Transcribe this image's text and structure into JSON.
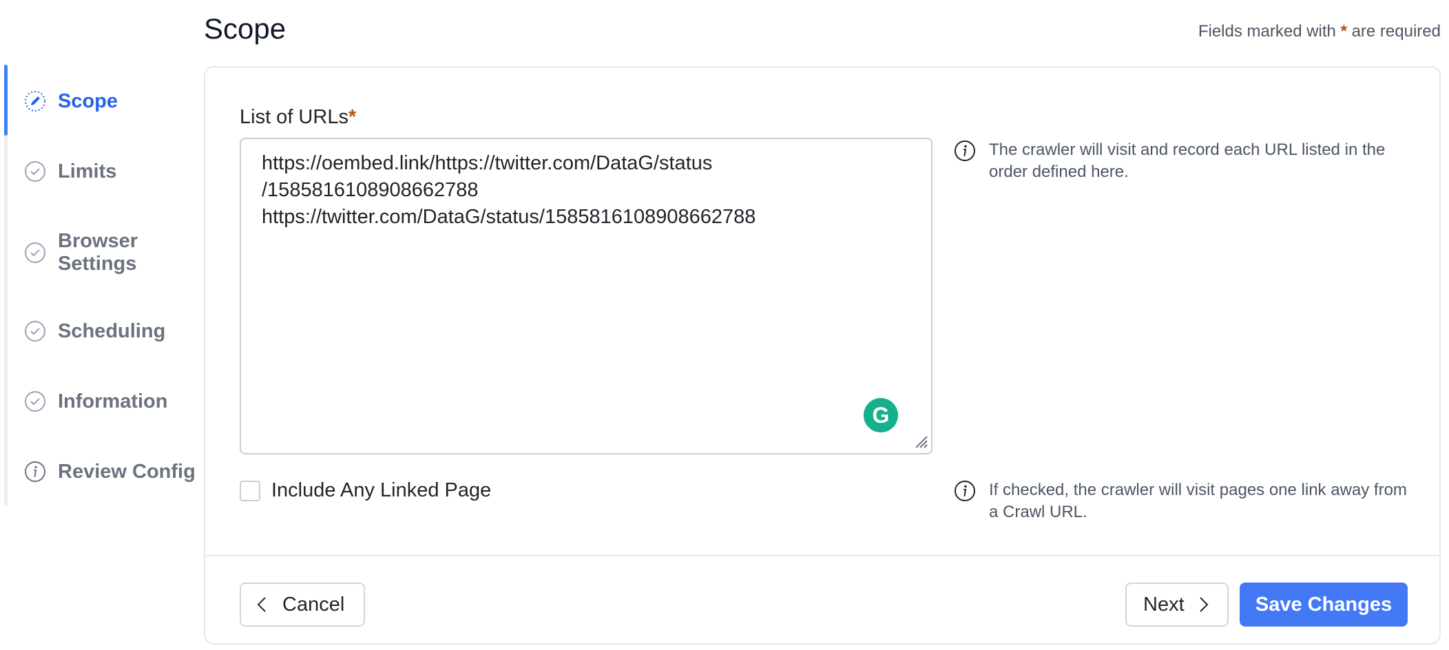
{
  "page": {
    "title": "Scope",
    "required_note_prefix": "Fields marked with",
    "required_note_star": "*",
    "required_note_suffix": "are required"
  },
  "sidebar": {
    "active_color": "#2563eb",
    "items": [
      {
        "label": "Scope",
        "icon": "pencil-dotted-circle-icon",
        "active": true
      },
      {
        "label": "Limits",
        "icon": "check-circle-icon"
      },
      {
        "label": "Browser Settings",
        "icon": "check-circle-icon"
      },
      {
        "label": "Scheduling",
        "icon": "check-circle-icon"
      },
      {
        "label": "Information",
        "icon": "check-circle-icon"
      },
      {
        "label": "Review Config",
        "icon": "info-circle-icon"
      }
    ]
  },
  "form": {
    "urls_label": "List of URLs",
    "urls_required_star": "*",
    "urls_value": "https://oembed.link/https://twitter.com/DataG/status\n/1585816108908662788\nhttps://twitter.com/DataG/status/1585816108908662788",
    "urls_help": "The crawler will visit and record each URL listed in the order defined here.",
    "linked_label": "Include Any Linked Page",
    "linked_checked": false,
    "linked_help": "If checked, the crawler will visit pages one link away from a Crawl URL."
  },
  "footer": {
    "cancel_label": "Cancel",
    "next_label": "Next",
    "save_label": "Save Changes",
    "save_color": "#4479f6"
  },
  "grammarly": {
    "glyph": "G",
    "color": "#16b08c"
  }
}
